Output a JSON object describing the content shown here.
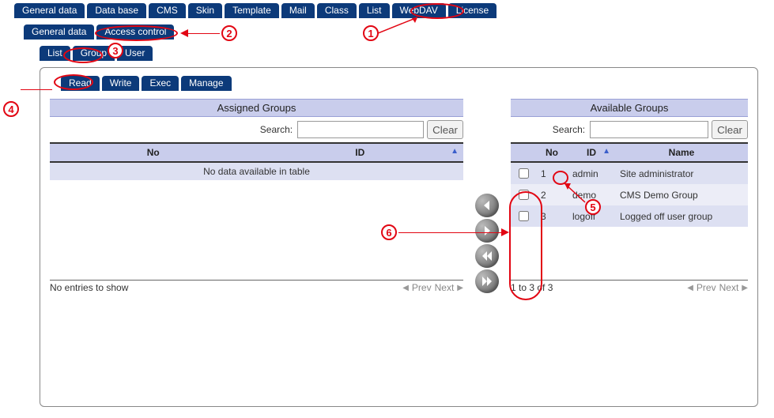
{
  "colors": {
    "accent": "#0c3a7a",
    "annotate": "#e20613",
    "header_bg": "#c9cdec"
  },
  "top_tabs": [
    "General data",
    "Data base",
    "CMS",
    "Skin",
    "Template",
    "Mail",
    "Class",
    "List",
    "WebDAV",
    "License"
  ],
  "sub_tabs": [
    "General data",
    "Access control"
  ],
  "sub_tabs2": [
    "List",
    "Group",
    "User"
  ],
  "perm_tabs": [
    "Read",
    "Write",
    "Exec",
    "Manage"
  ],
  "left": {
    "title": "Assigned Groups",
    "search_label": "Search:",
    "clear": "Clear",
    "search_value": "",
    "columns": [
      "No",
      "ID"
    ],
    "no_data": "No data available in table",
    "pager_info": "No entries to show",
    "prev": "Prev",
    "next": "Next"
  },
  "right": {
    "title": "Available Groups",
    "search_label": "Search:",
    "clear": "Clear",
    "search_value": "",
    "columns": [
      "",
      "No",
      "ID",
      "Name"
    ],
    "rows": [
      {
        "no": "1",
        "id": "admin",
        "name": "Site administrator"
      },
      {
        "no": "2",
        "id": "demo",
        "name": "CMS Demo Group"
      },
      {
        "no": "3",
        "id": "logoff",
        "name": "Logged off user group"
      }
    ],
    "pager_info": "1 to 3 of 3",
    "prev": "Prev",
    "next": "Next"
  },
  "annotations": {
    "1": "1",
    "2": "2",
    "3": "3",
    "4": "4",
    "5": "5",
    "6": "6"
  }
}
